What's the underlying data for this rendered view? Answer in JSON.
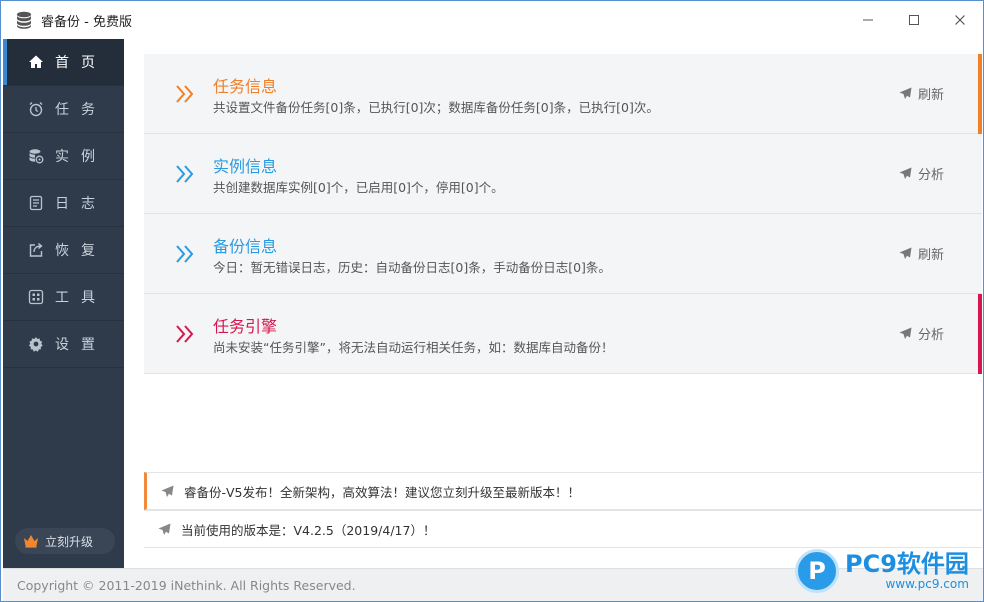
{
  "window": {
    "title": "睿备份 - 免费版",
    "controls": {
      "minimize": "—",
      "maximize": "☐",
      "close": "✕"
    }
  },
  "sidebar": {
    "items": [
      {
        "label": "首页",
        "icon": "home-icon",
        "active": true
      },
      {
        "label": "任务",
        "icon": "alarm-clock-icon",
        "active": false
      },
      {
        "label": "实例",
        "icon": "database-icon",
        "active": false
      },
      {
        "label": "日志",
        "icon": "log-file-icon",
        "active": false
      },
      {
        "label": "恢复",
        "icon": "export-icon",
        "active": false
      },
      {
        "label": "工具",
        "icon": "grid-icon",
        "active": false
      },
      {
        "label": "设置",
        "icon": "gear-icon",
        "active": false
      }
    ],
    "upgrade_label": "立刻升级"
  },
  "cards": [
    {
      "title": "任务信息",
      "desc": "共设置文件备份任务[0]条，已执行[0]次；数据库备份任务[0]条，已执行[0]次。",
      "action": "刷新",
      "color": "#f07f2a"
    },
    {
      "title": "实例信息",
      "desc": "共创建数据库实例[0]个，已启用[0]个，停用[0]个。",
      "action": "分析",
      "color": "#2b9be0"
    },
    {
      "title": "备份信息",
      "desc": "今日：暂无错误日志，历史：自动备份日志[0]条，手动备份日志[0]条。",
      "action": "刷新",
      "color": "#2b9be0"
    },
    {
      "title": "任务引擎",
      "desc": "尚未安装“任务引擎”，将无法自动运行相关任务，如：数据库自动备份！",
      "action": "分析",
      "color": "#d6164e"
    }
  ],
  "notices": [
    {
      "text": "睿备份-V5发布！全新架构，高效算法！建议您立刻升级至最新版本！！"
    },
    {
      "text": "当前使用的版本是：V4.2.5（2019/4/17）！"
    }
  ],
  "footer": {
    "copyright": "Copyright © 2011-2019 iNethink. All Rights Reserved."
  },
  "watermark": {
    "name": "PC9软件园",
    "domain": "www.pc9.com"
  }
}
